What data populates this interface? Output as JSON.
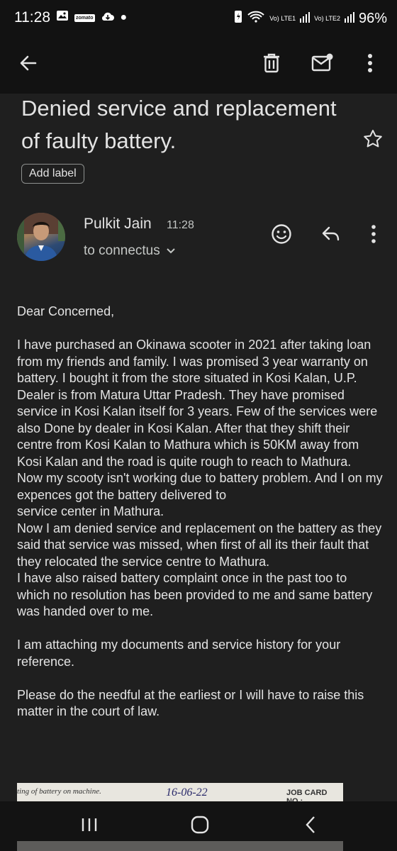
{
  "status_bar": {
    "time": "11:28",
    "zomato_text": "zomato",
    "lte1": "Vo) LTE1",
    "lte2": "Vo) LTE2",
    "battery": "96%"
  },
  "email": {
    "subject": "Denied service and replacement of faulty battery.",
    "add_label": "Add label",
    "sender": "Pulkit Jain",
    "time": "11:28",
    "recipient": "to connectus",
    "paragraphs": [
      "Dear Concerned,",
      "I have purchased an Okinawa scooter in 2021 after taking loan from my friends and family. I was promised 3 year warranty on battery. I bought it from the store situated in Kosi Kalan, U.P.\nDealer is from Matura Uttar Pradesh. They have promised service in Kosi Kalan itself for 3 years. Few of the services were also Done by dealer in Kosi Kalan. After that they shift their centre from Kosi Kalan to Mathura which is 50KM away from Kosi Kalan and the road is quite rough to reach to Mathura.\nNow my scooty isn't working due to battery problem. And I on my expences got the battery delivered to\nservice center in Mathura.\nNow I am denied service and replacement on the battery as they said that service was missed, when first of all its their fault that they relocated the service centre to Mathura.\nI have also raised battery complaint once in the past too to which no resolution has been provided to me and same battery was handed over to me.",
      "I am attaching my documents and service history for your reference.",
      "Please do the needful at the earliest or I will have to raise this matter in the court of law."
    ]
  },
  "attachment": {
    "text_left": "ting of battery on machine.",
    "date": "16-06-22",
    "job_card": "JOB CARD NO.:"
  },
  "icons": {
    "back": "arrow-back-icon",
    "delete": "trash-icon",
    "mark_unread": "mail-unread-icon",
    "more": "more-vert-icon",
    "star": "star-outline-icon",
    "emoji": "emoji-smile-icon",
    "reply": "reply-icon"
  }
}
